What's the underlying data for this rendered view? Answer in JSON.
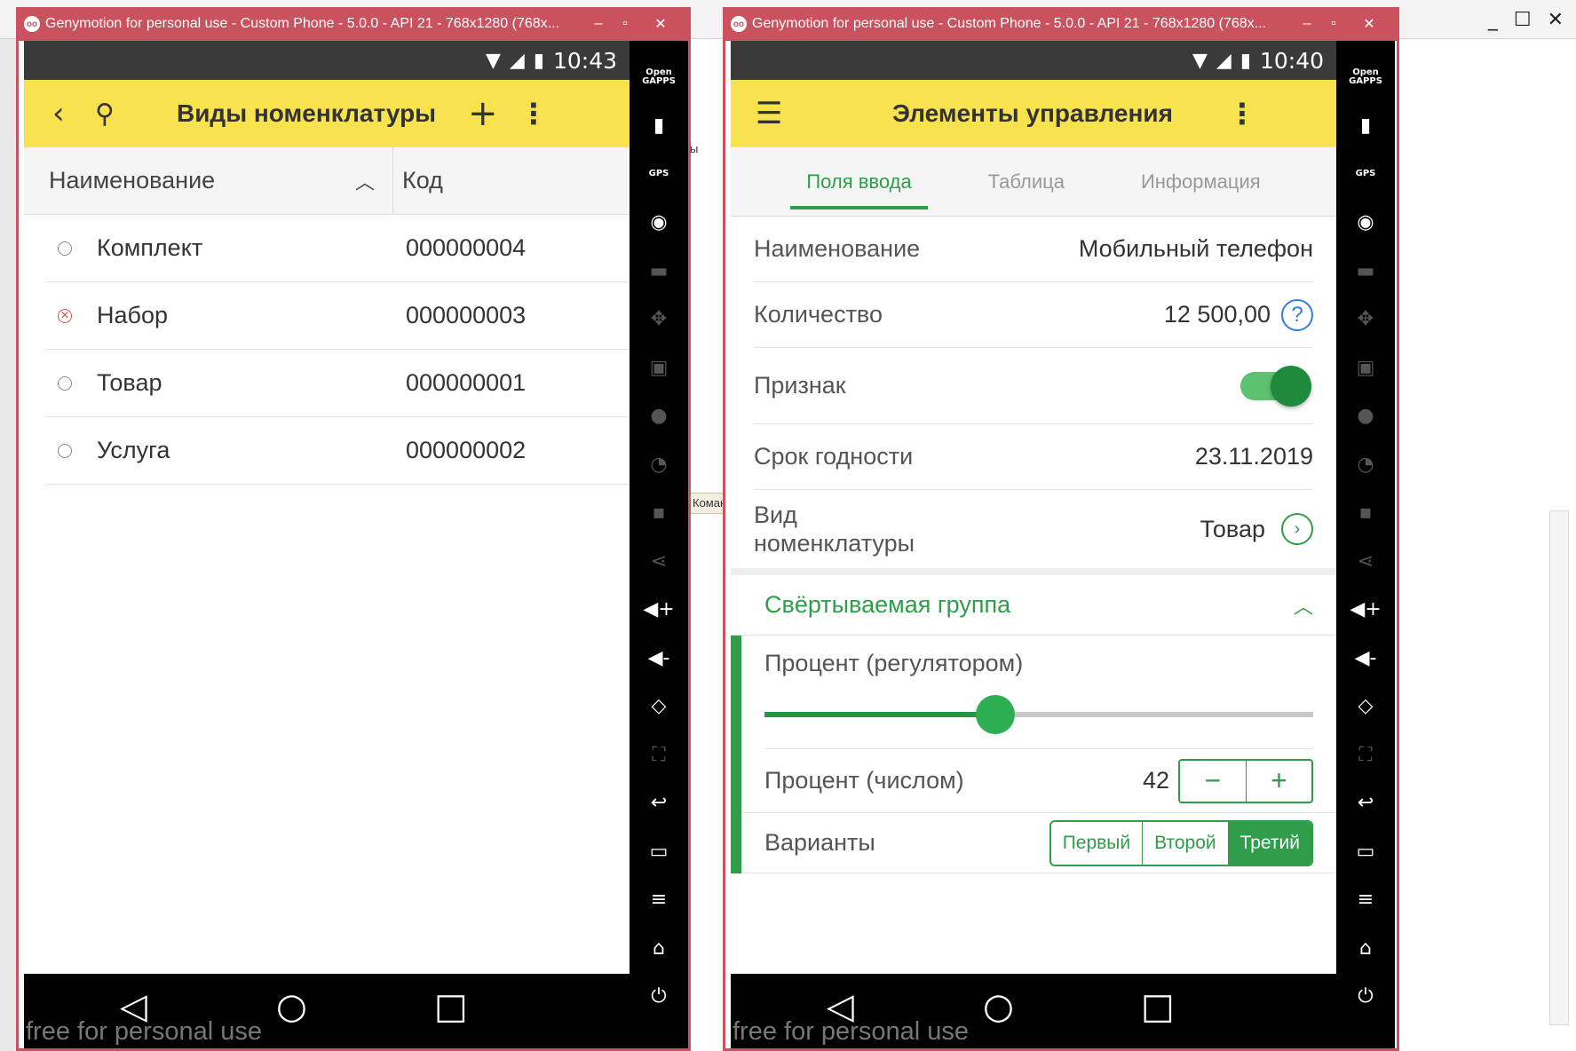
{
  "emulator1": {
    "title": "Genymotion for personal use - Custom Phone - 5.0.0 - API 21 - 768x1280 (768x...",
    "status": {
      "time": "10:43"
    },
    "appbar": {
      "title": "Виды номенклатуры"
    },
    "table": {
      "columns": [
        "Наименование",
        "Код"
      ],
      "rows": [
        {
          "name": "Комплект",
          "code": "000000004",
          "marked": false
        },
        {
          "name": "Набор",
          "code": "000000003",
          "marked": true
        },
        {
          "name": "Товар",
          "code": "000000001",
          "marked": false
        },
        {
          "name": "Услуга",
          "code": "000000002",
          "marked": false
        }
      ]
    },
    "watermark": "free for personal use"
  },
  "emulator2": {
    "title": "Genymotion for personal use - Custom Phone - 5.0.0 - API 21 - 768x1280 (768x...",
    "status": {
      "time": "10:40"
    },
    "appbar": {
      "title": "Элементы управления"
    },
    "tabs": [
      "Поля ввода",
      "Таблица",
      "Информация"
    ],
    "fields": {
      "name_label": "Наименование",
      "name_value": "Мобильный телефон",
      "qty_label": "Количество",
      "qty_value": "12 500,00",
      "flag_label": "Признак",
      "expiry_label": "Срок годности",
      "expiry_value": "23.11.2019",
      "kind_label": "Вид номенклатуры",
      "kind_value": "Товар"
    },
    "group": {
      "title": "Свёртываемая группа",
      "slider_label": "Процент (регулятором)",
      "slider_value": 0.42,
      "number_label": "Процент (числом)",
      "number_value": "42",
      "variants_label": "Варианты",
      "variants": [
        "Первый",
        "Второй",
        "Третий"
      ],
      "selected_variant": "Третий"
    },
    "watermark": "free for personal use"
  },
  "host": {
    "ghost_text": "ы",
    "strip_text": "Коман"
  },
  "colors": {
    "accent_green": "#2f9d4a",
    "appbar_yellow": "#f8e24e",
    "frame_red": "#c9525e"
  }
}
